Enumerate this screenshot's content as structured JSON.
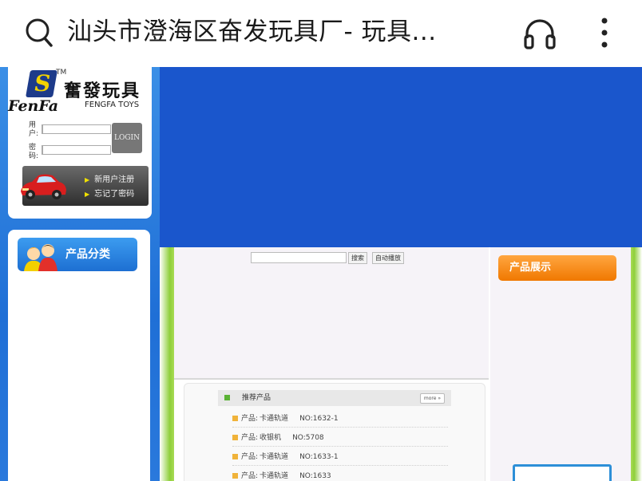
{
  "browser": {
    "title": "汕头市澄海区奋发玩具厂- 玩具...",
    "icons": [
      "search-icon",
      "headset-icon",
      "more-vert-icon"
    ]
  },
  "logo": {
    "mark": "S",
    "tm": "TM",
    "name_cn": "奮發玩具",
    "name_en": "FenFa",
    "sub_en": "FENGFA TOYS"
  },
  "login": {
    "user_label": "用户:",
    "pass_label": "密码:",
    "button": "LOGIN",
    "links": [
      "新用户注册",
      "忘记了密码"
    ]
  },
  "category": {
    "title": "产品分类"
  },
  "search": {
    "buttons": [
      "搜索",
      "自动播放"
    ]
  },
  "recommended": {
    "title": "推荐产品",
    "more": "more »",
    "items": [
      {
        "label": "产品:",
        "name": "卡通轨道",
        "no": "NO:1632-1"
      },
      {
        "label": "产品:",
        "name": "收银机",
        "no": "NO:5708"
      },
      {
        "label": "产品:",
        "name": "卡通轨道",
        "no": "NO:1633-1"
      },
      {
        "label": "产品:",
        "name": "卡通轨道",
        "no": "NO:1633"
      }
    ]
  },
  "products": {
    "title": "产品展示"
  },
  "colors": {
    "banner": "#1a56cc",
    "page_bg": "#1f7fe0",
    "accent_orange": "#f07800",
    "accent_green": "#8fcf3a"
  }
}
